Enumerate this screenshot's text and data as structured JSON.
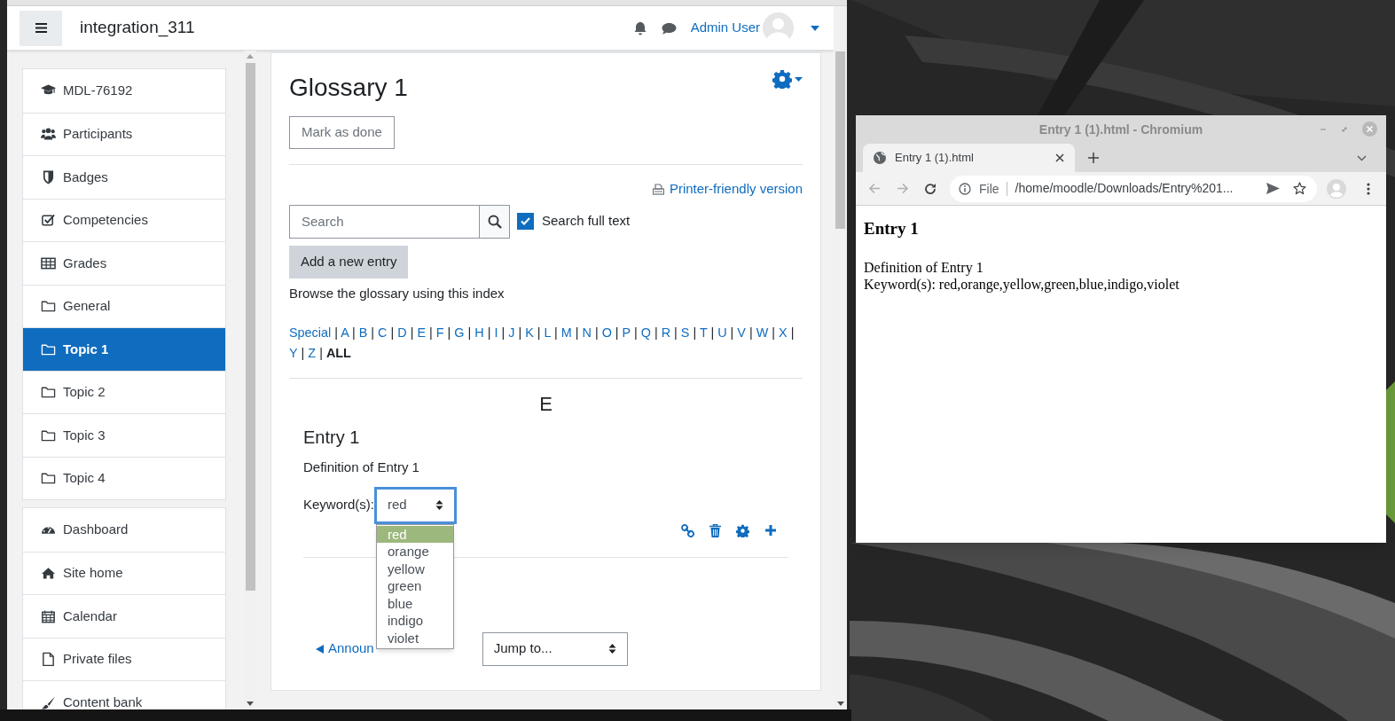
{
  "moodle": {
    "site_name": "integration_311",
    "user_name": "Admin User",
    "sidebar": {
      "sections": [
        [
          {
            "label": "MDL-76192",
            "kind": "cap",
            "selected": false
          },
          {
            "label": "Participants",
            "kind": "users",
            "selected": false
          },
          {
            "label": "Badges",
            "kind": "shield",
            "selected": false
          },
          {
            "label": "Competencies",
            "kind": "check",
            "selected": false
          },
          {
            "label": "Grades",
            "kind": "table",
            "selected": false
          },
          {
            "label": "General",
            "kind": "folder",
            "selected": false
          },
          {
            "label": "Topic 1",
            "kind": "folder",
            "selected": true
          },
          {
            "label": "Topic 2",
            "kind": "folder",
            "selected": false
          },
          {
            "label": "Topic 3",
            "kind": "folder",
            "selected": false
          },
          {
            "label": "Topic 4",
            "kind": "folder",
            "selected": false
          }
        ],
        [
          {
            "label": "Dashboard",
            "kind": "gauge",
            "selected": false
          },
          {
            "label": "Site home",
            "kind": "home",
            "selected": false
          },
          {
            "label": "Calendar",
            "kind": "calendar",
            "selected": false
          },
          {
            "label": "Private files",
            "kind": "file",
            "selected": false
          },
          {
            "label": "Content bank",
            "kind": "brush",
            "selected": false
          }
        ]
      ]
    },
    "page": {
      "title": "Glossary 1",
      "mark_done": "Mark as done",
      "printer_link": "Printer-friendly version",
      "search": {
        "placeholder": "Search"
      },
      "full_text": {
        "label": "Search full text",
        "checked": true
      },
      "add_button": "Add a new entry",
      "browse_label": "Browse the glossary using this index",
      "index": {
        "separator": "|",
        "items": [
          {
            "label": "Special",
            "selected": false
          },
          {
            "label": "A",
            "selected": false
          },
          {
            "label": "B",
            "selected": false
          },
          {
            "label": "C",
            "selected": false
          },
          {
            "label": "D",
            "selected": false
          },
          {
            "label": "E",
            "selected": false
          },
          {
            "label": "F",
            "selected": false
          },
          {
            "label": "G",
            "selected": false
          },
          {
            "label": "H",
            "selected": false
          },
          {
            "label": "I",
            "selected": false
          },
          {
            "label": "J",
            "selected": false
          },
          {
            "label": "K",
            "selected": false
          },
          {
            "label": "L",
            "selected": false
          },
          {
            "label": "M",
            "selected": false
          },
          {
            "label": "N",
            "selected": false
          },
          {
            "label": "O",
            "selected": false
          },
          {
            "label": "P",
            "selected": false
          },
          {
            "label": "Q",
            "selected": false
          },
          {
            "label": "R",
            "selected": false
          },
          {
            "label": "S",
            "selected": false
          },
          {
            "label": "T",
            "selected": false
          },
          {
            "label": "U",
            "selected": false
          },
          {
            "label": "V",
            "selected": false
          },
          {
            "label": "W",
            "selected": false
          },
          {
            "label": "X",
            "selected": false
          },
          {
            "label": "Y",
            "selected": false
          },
          {
            "label": "Z",
            "selected": false
          },
          {
            "label": "ALL",
            "selected": true
          }
        ]
      },
      "letter_heading": "E",
      "entry": {
        "title": "Entry 1",
        "definition": "Definition of Entry 1",
        "keywords_label": "Keyword(s):",
        "keyword_select": {
          "value": "red",
          "expanded": true,
          "options": [
            {
              "label": "red",
              "selected": true
            },
            {
              "label": "orange",
              "selected": false
            },
            {
              "label": "yellow",
              "selected": false
            },
            {
              "label": "green",
              "selected": false
            },
            {
              "label": "blue",
              "selected": false
            },
            {
              "label": "indigo",
              "selected": false
            },
            {
              "label": "violet",
              "selected": false
            }
          ]
        }
      },
      "prev_link": "Announ",
      "jump_select": {
        "value": "Jump to..."
      }
    }
  },
  "chromium": {
    "title": "Entry 1 (1).html - Chromium",
    "tab": {
      "label": "Entry 1 (1).html"
    },
    "address": {
      "scheme": "File",
      "url": "/home/moodle/Downloads/Entry%201..."
    },
    "content": {
      "heading": "Entry 1",
      "lines": [
        "Definition of Entry 1",
        "Keyword(s): red,orange,yellow,green,blue,indigo,violet"
      ]
    }
  }
}
